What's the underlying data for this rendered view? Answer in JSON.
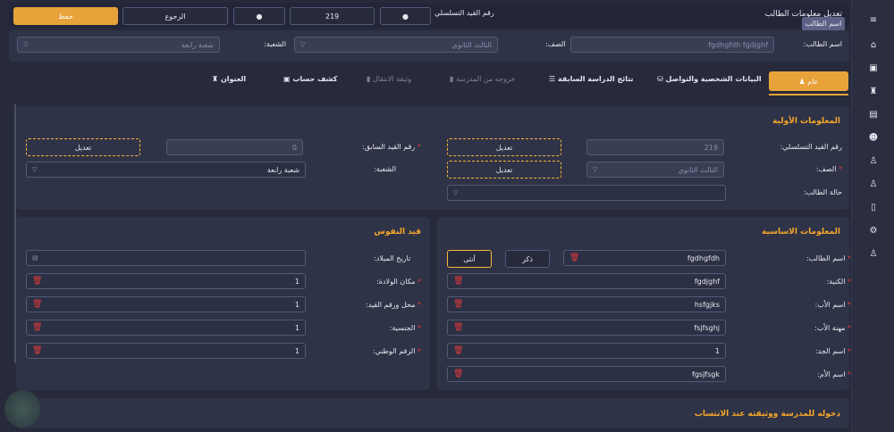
{
  "header": {
    "title": "تعديل معلومات الطالب",
    "serial_label": "رقم القيد التسلسلي",
    "serial_value": "219",
    "save": "حفظ",
    "back": "الرجوع",
    "tooltip": "اسم الطالب"
  },
  "filter": {
    "name_label": "اسم الطالب:",
    "name_value": "fgdhgfdh fgdjghf",
    "grade_label": "الصف:",
    "grade_value": "الثالث الثانوي",
    "section_label": "الشعبة:",
    "section_value": "شعبة رابعة"
  },
  "tabs": [
    {
      "label": "عام"
    },
    {
      "label": "البيانات الشخصية والتواصل"
    },
    {
      "label": "نتائج الدراسة السابقة"
    },
    {
      "label": "خروجه من المدرسة"
    },
    {
      "label": "وثيقة الانتقال"
    },
    {
      "label": "كشف حساب"
    },
    {
      "label": "العنوان"
    }
  ],
  "initial": {
    "title": "المعلومات الأولية",
    "serial_label": "رقم القيد التسلسلي:",
    "serial_value": "219",
    "edit": "تعديل",
    "prev_label": "رقم القيد السابق:",
    "prev_value": "0",
    "grade_label": "الصف:",
    "grade_value": "الثالث الثانوي",
    "section_label": "الشعبة:",
    "section_value": "شعبة رابعة",
    "status_label": "حالة الطالب:",
    "status_value": ""
  },
  "basic": {
    "title": "المعلومات الاساسية",
    "male": "ذكر",
    "female": "أنثى",
    "fields": [
      {
        "label": "اسم الطالب:",
        "value": "fgdhgfdh"
      },
      {
        "label": "الكنية:",
        "value": "fgdjghf"
      },
      {
        "label": "اسم الأب:",
        "value": "hsfgjks"
      },
      {
        "label": "مهنة الأب:",
        "value": "fsjfsghj"
      },
      {
        "label": "اسم الجد:",
        "value": "1"
      },
      {
        "label": "اسم الأم:",
        "value": "fgsjfsgk"
      }
    ]
  },
  "civil": {
    "title": "قيد النفوس",
    "birth_label": "تاريخ الميلاد:",
    "birth_value": "",
    "fields": [
      {
        "label": "مكان الولادة:",
        "value": "1"
      },
      {
        "label": "محل ورقم القيد:",
        "value": "1"
      },
      {
        "label": "الجنسية:",
        "value": "1"
      },
      {
        "label": "الرقم الوطني:",
        "value": "1"
      }
    ]
  },
  "bottom": {
    "title": "دخوله للمدرسة ووثيقته عند الانتساب"
  },
  "colors": {
    "accent": "#e8a23a",
    "bg": "#262a3b",
    "card": "#2f3347",
    "danger": "#e23a3a"
  }
}
